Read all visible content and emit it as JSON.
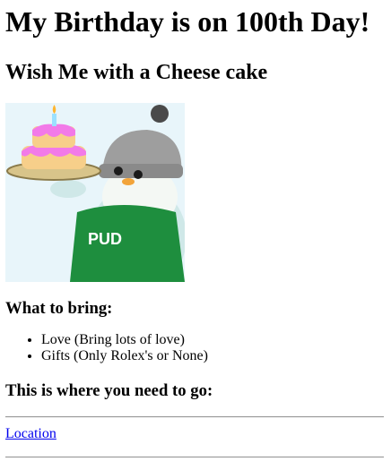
{
  "page": {
    "title": "My Birthday is on 100th Day!",
    "subtitle": "Wish Me with a Cheese cake",
    "image": {
      "name": "penguin-holding-cake",
      "apron_text": "PUD",
      "colors": {
        "background": "#e8f5fa",
        "apron": "#1e8e3e",
        "hat": "#9e9e9e",
        "frosting": "#f27ae8",
        "cake": "#f7cf8a",
        "tray": "#d8c48a"
      }
    },
    "bring_heading": "What to bring:",
    "bring_items": [
      "Love (Bring lots of love)",
      "Gifts (Only Rolex's or None)"
    ],
    "go_heading": "This is where you need to go:",
    "location_link": "Location",
    "link_color": "#0000ee"
  }
}
